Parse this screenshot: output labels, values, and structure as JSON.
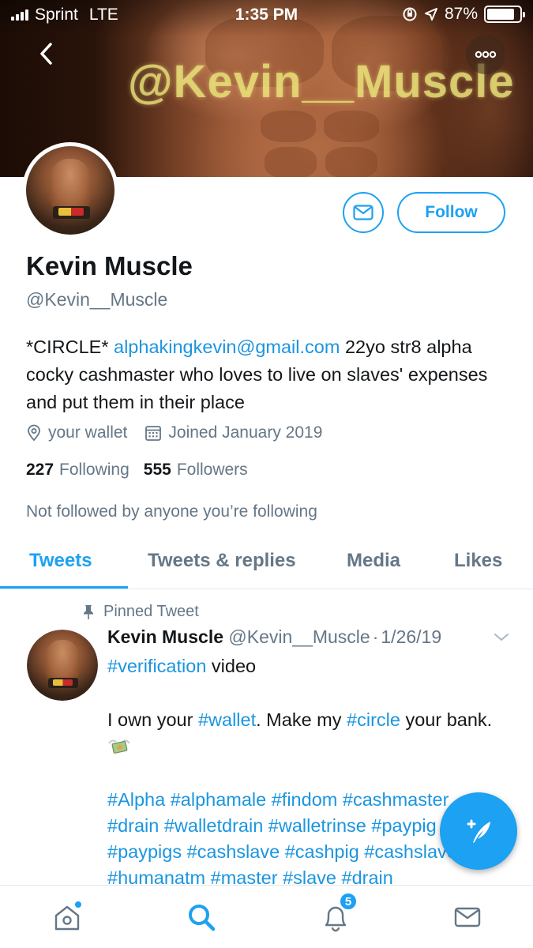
{
  "status_bar": {
    "carrier": "Sprint",
    "network": "LTE",
    "time": "1:35 PM",
    "battery": "87%",
    "battery_level": 0.87
  },
  "header": {
    "watermark": "@Kevin__Muscle",
    "back_icon": "chevron-left-icon",
    "more_icon": "more-dots-icon"
  },
  "profile": {
    "name": "Kevin Muscle",
    "handle": "@Kevin__Muscle",
    "bio_prefix": "*CIRCLE* ",
    "bio_link": "alphakingkevin@gmail.com",
    "bio_suffix": " 22yo str8 alpha cocky cashmaster who loves to live on slaves' expenses and put them in their place",
    "location": "your wallet",
    "joined": "Joined January 2019",
    "following_count": "227",
    "following_label": "Following",
    "followers_count": "555",
    "followers_label": "Followers",
    "not_followed": "Not followed by anyone you’re following",
    "follow_label": "Follow"
  },
  "tabs": [
    {
      "label": "Tweets",
      "active": true
    },
    {
      "label": "Tweets & replies",
      "active": false
    },
    {
      "label": "Media",
      "active": false
    },
    {
      "label": "Likes",
      "active": false
    }
  ],
  "tweet": {
    "pinned_label": "Pinned Tweet",
    "author_name": "Kevin Muscle",
    "author_handle": "@Kevin__Muscle",
    "separator": "·",
    "date": "1/26/19",
    "line1_tag": "#verification",
    "line1_text": " video",
    "line2_a": "I own your ",
    "line2_tag1": "#wallet",
    "line2_b": ". Make my ",
    "line2_tag2": "#circle",
    "line2_c": " your bank.",
    "hashtags_line1": "#Alpha #alphamale #findom #cashmaster",
    "hashtags_line2": "#drain #walletdrain #walletrinse #paypig",
    "hashtags_line3": "#paypigs #cashslave #cashpig #cashslave",
    "hashtags_line4": "#humanatm #master #slave #drain"
  },
  "bottom_nav": {
    "items": [
      "home-icon",
      "search-icon",
      "notifications-icon",
      "messages-icon"
    ],
    "notifications_badge": "5"
  },
  "colors": {
    "accent": "#1da1f2",
    "link": "#1b95e0",
    "text": "#14171a",
    "secondary": "#657786"
  }
}
